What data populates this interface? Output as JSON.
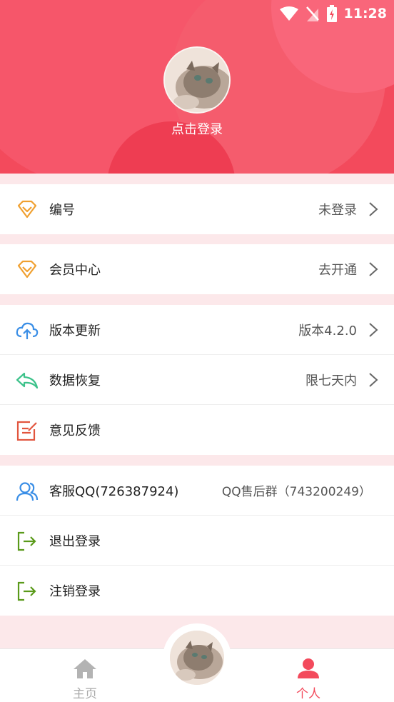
{
  "status_bar": {
    "time": "11:28"
  },
  "header": {
    "login_text": "点击登录"
  },
  "menu": {
    "id_row": {
      "label": "编号",
      "value": "未登录"
    },
    "vip_row": {
      "label": "会员中心",
      "value": "去开通"
    },
    "update_row": {
      "label": "版本更新",
      "value": "版本4.2.0"
    },
    "restore_row": {
      "label": "数据恢复",
      "value": "限七天内"
    },
    "feedback_row": {
      "label": "意见反馈"
    },
    "service_row": {
      "label": "客服QQ(726387924)",
      "value": "QQ售后群（743200249）"
    },
    "logout_row": {
      "label": "退出登录"
    },
    "cancel_row": {
      "label": "注销登录"
    }
  },
  "bottom_nav": {
    "home": {
      "label": "主页"
    },
    "me": {
      "label": "个人"
    }
  },
  "colors": {
    "accent": "#f34a5c",
    "diamond": "#f0a030",
    "cloud": "#3a8ee6",
    "restore": "#3cc28a",
    "feedback": "#e2553e",
    "service": "#3a8ee6",
    "exit": "#5a9a1a"
  }
}
